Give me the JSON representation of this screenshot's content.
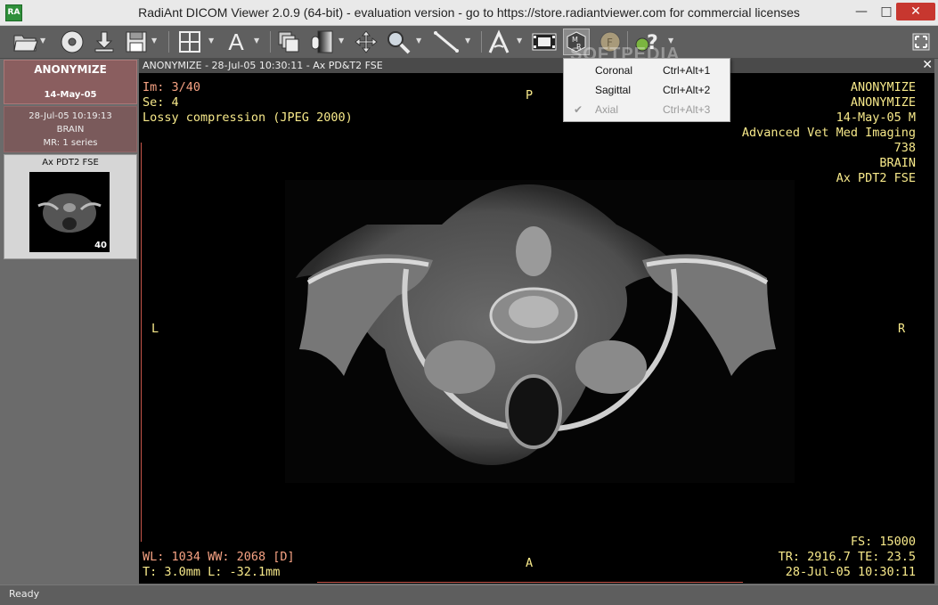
{
  "window": {
    "title": "RadiAnt DICOM Viewer 2.0.9 (64-bit) - evaluation version - go to https://store.radiantviewer.com for commercial licenses",
    "icon_label": "RA"
  },
  "toolbar": {
    "buttons": [
      {
        "icon": "open-folder-icon"
      },
      {
        "icon": "cd-dvd-icon",
        "label": "CD DVD"
      },
      {
        "icon": "download-icon"
      },
      {
        "icon": "save-icon"
      },
      {
        "icon": "layout-grid-icon"
      },
      {
        "icon": "text-annotation-icon",
        "label": "A"
      },
      {
        "icon": "series-stack-icon"
      },
      {
        "icon": "window-level-icon"
      },
      {
        "icon": "pan-icon"
      },
      {
        "icon": "zoom-icon"
      },
      {
        "icon": "measure-ruler-icon"
      },
      {
        "icon": "angle-icon"
      },
      {
        "icon": "cine-film-icon"
      },
      {
        "icon": "mpr-icon",
        "label": "M R"
      },
      {
        "icon": "fusion-icon",
        "label": "F"
      },
      {
        "icon": "help-icon",
        "label": "?"
      }
    ]
  },
  "sidebar": {
    "patient_name": "ANONYMIZE",
    "patient_date": "14-May-05",
    "study": {
      "datetime": "28-Jul-05 10:19:13",
      "description": "BRAIN",
      "summary": "MR: 1 series"
    },
    "series": {
      "label": "Ax PDT2 FSE",
      "count": "40"
    }
  },
  "viewer": {
    "header": "ANONYMIZE - 28-Jul-05 10:30:11 - Ax PD&T2 FSE",
    "top_left": [
      "Im: 3/40",
      "Se: 4",
      "Lossy compression (JPEG 2000)"
    ],
    "top_right": [
      "ANONYMIZE",
      "ANONYMIZE",
      "14-May-05 M",
      "Advanced Vet Med Imaging",
      "738",
      "BRAIN",
      "Ax PDT2 FSE"
    ],
    "bottom_left": [
      "WL: 1034 WW: 2068 [D]",
      "T: 3.0mm L: -32.1mm"
    ],
    "bottom_right": [
      "FS: 15000",
      "TR: 2916.7 TE: 23.5",
      "28-Jul-05 10:30:11"
    ],
    "orientation": {
      "top": "P",
      "bottom": "A",
      "left": "L",
      "right": "R"
    }
  },
  "mpr_menu": {
    "items": [
      {
        "label": "Coronal",
        "shortcut": "Ctrl+Alt+1",
        "enabled": true,
        "checked": false
      },
      {
        "label": "Sagittal",
        "shortcut": "Ctrl+Alt+2",
        "enabled": true,
        "checked": false
      },
      {
        "label": "Axial",
        "shortcut": "Ctrl+Alt+3",
        "enabled": false,
        "checked": true
      }
    ]
  },
  "status": {
    "text": "Ready"
  },
  "watermark": "SOFTPEDIA",
  "colors": {
    "overlay_salmon": "#f6a283",
    "overlay_yellow": "#f7e98a",
    "patient_bg": "#8a5e5f",
    "close_red": "#c7372f"
  }
}
